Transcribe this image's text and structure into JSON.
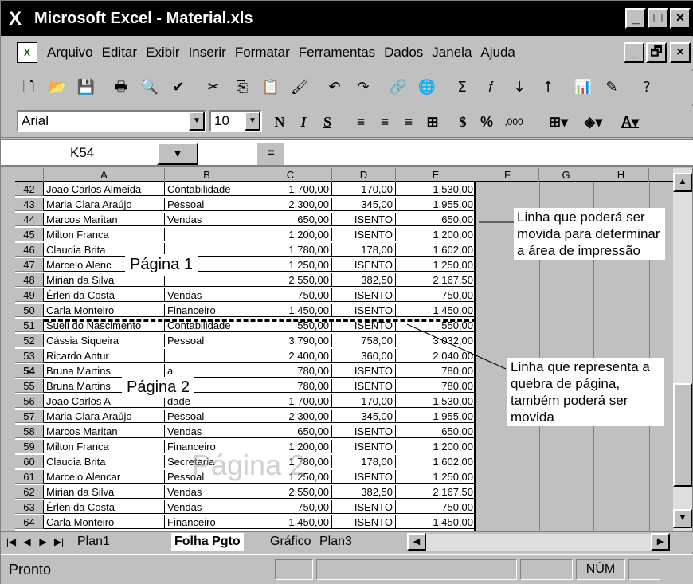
{
  "window": {
    "title": "Microsoft Excel - Material.xls",
    "app_icon": "X"
  },
  "window_buttons": {
    "minimize": "_",
    "maximize": "□",
    "close": "×"
  },
  "menu": {
    "items": [
      "Arquivo",
      "Editar",
      "Exibir",
      "Inserir",
      "Formatar",
      "Ferramentas",
      "Dados",
      "Janela",
      "Ajuda"
    ]
  },
  "toolbar_standard": [
    {
      "icon": "new-document-icon",
      "glyph": "🗋"
    },
    {
      "icon": "open-folder-icon",
      "glyph": "📂"
    },
    {
      "icon": "save-icon",
      "glyph": "💾"
    },
    {
      "icon": "print-icon",
      "glyph": "🖶"
    },
    {
      "icon": "print-preview-icon",
      "glyph": "🔍"
    },
    {
      "icon": "spelling-icon",
      "glyph": "✔"
    },
    {
      "icon": "cut-icon",
      "glyph": "✂"
    },
    {
      "icon": "copy-icon",
      "glyph": "⎘"
    },
    {
      "icon": "paste-icon",
      "glyph": "📋"
    },
    {
      "icon": "format-painter-icon",
      "glyph": "🖌"
    },
    {
      "icon": "undo-icon",
      "glyph": "↶"
    },
    {
      "icon": "redo-icon",
      "glyph": "↷"
    },
    {
      "icon": "hyperlink-icon",
      "glyph": "🔗"
    },
    {
      "icon": "web-toolbar-icon",
      "glyph": "🌐"
    },
    {
      "icon": "autosum-icon",
      "glyph": "Σ"
    },
    {
      "icon": "function-icon",
      "glyph": "𝑓"
    },
    {
      "icon": "sort-ascending-icon",
      "glyph": "↓"
    },
    {
      "icon": "sort-descending-icon",
      "glyph": "↑"
    },
    {
      "icon": "chart-wizard-icon",
      "glyph": "📊"
    },
    {
      "icon": "drawing-icon",
      "glyph": "✎"
    },
    {
      "icon": "help-icon",
      "glyph": "?"
    }
  ],
  "format": {
    "font": "Arial",
    "size": "10",
    "bold": "N",
    "italic": "I",
    "underline": "S",
    "percent": "%",
    "thousands": ",000"
  },
  "formula_bar": {
    "cell_ref": "K54",
    "equals": "="
  },
  "columns": [
    "A",
    "B",
    "C",
    "D",
    "E",
    "F",
    "G",
    "H"
  ],
  "rows": [
    {
      "n": "42",
      "a": "Joao Carlos Almeida",
      "b": "Contabilidade",
      "c": "1.700,00",
      "d": "170,00",
      "e": "1.530,00"
    },
    {
      "n": "43",
      "a": "Maria Clara Araújo",
      "b": "Pessoal",
      "c": "2.300,00",
      "d": "345,00",
      "e": "1.955,00"
    },
    {
      "n": "44",
      "a": "Marcos Maritan",
      "b": "Vendas",
      "c": "650,00",
      "d": "ISENTO",
      "e": "650,00"
    },
    {
      "n": "45",
      "a": "Milton Franca",
      "b": "",
      "c": "1.200,00",
      "d": "ISENTO",
      "e": "1.200,00"
    },
    {
      "n": "46",
      "a": "Claudia Brita",
      "b": "",
      "c": "1.780,00",
      "d": "178,00",
      "e": "1.602,00"
    },
    {
      "n": "47",
      "a": "Marcelo Alenc",
      "b": "",
      "c": "1.250,00",
      "d": "ISENTO",
      "e": "1.250,00"
    },
    {
      "n": "48",
      "a": "Mirian da Silva",
      "b": "",
      "c": "2.550,00",
      "d": "382,50",
      "e": "2.167,50"
    },
    {
      "n": "49",
      "a": "Érlen da Costa",
      "b": "Vendas",
      "c": "750,00",
      "d": "ISENTO",
      "e": "750,00"
    },
    {
      "n": "50",
      "a": "Carla Monteiro",
      "b": "Financeiro",
      "c": "1.450,00",
      "d": "ISENTO",
      "e": "1.450,00"
    },
    {
      "n": "51",
      "a": "Sueli do Nascimento",
      "b": "Contabilidade",
      "c": "550,00",
      "d": "ISENTO",
      "e": "550,00"
    },
    {
      "n": "52",
      "a": "Cássia Siqueira",
      "b": "Pessoal",
      "c": "3.790,00",
      "d": "758,00",
      "e": "3.032,00"
    },
    {
      "n": "53",
      "a": "Ricardo Antur",
      "b": "",
      "c": "2.400,00",
      "d": "360,00",
      "e": "2.040,00"
    },
    {
      "n": "54",
      "a": "Bruna Martins",
      "b": "a",
      "c": "780,00",
      "d": "ISENTO",
      "e": "780,00"
    },
    {
      "n": "55",
      "a": "Bruna Martins",
      "b": "a",
      "c": "780,00",
      "d": "ISENTO",
      "e": "780,00"
    },
    {
      "n": "56",
      "a": "Joao Carlos A",
      "b": "dade",
      "c": "1.700,00",
      "d": "170,00",
      "e": "1.530,00"
    },
    {
      "n": "57",
      "a": "Maria Clara Araújo",
      "b": "Pessoal",
      "c": "2.300,00",
      "d": "345,00",
      "e": "1.955,00"
    },
    {
      "n": "58",
      "a": "Marcos Maritan",
      "b": "Vendas",
      "c": "650,00",
      "d": "ISENTO",
      "e": "650,00"
    },
    {
      "n": "59",
      "a": "Milton Franca",
      "b": "Financeiro",
      "c": "1.200,00",
      "d": "ISENTO",
      "e": "1.200,00"
    },
    {
      "n": "60",
      "a": "Claudia Brita",
      "b": "Secretaria",
      "c": "1.780,00",
      "d": "178,00",
      "e": "1.602,00"
    },
    {
      "n": "61",
      "a": "Marcelo Alencar",
      "b": "Pessoal",
      "c": "1.250,00",
      "d": "ISENTO",
      "e": "1.250,00"
    },
    {
      "n": "62",
      "a": "Mirian da Silva",
      "b": "Vendas",
      "c": "2.550,00",
      "d": "382,50",
      "e": "2.167,50"
    },
    {
      "n": "63",
      "a": "Érlen da Costa",
      "b": "Vendas",
      "c": "750,00",
      "d": "ISENTO",
      "e": "750,00"
    },
    {
      "n": "64",
      "a": "Carla Monteiro",
      "b": "Financeiro",
      "c": "1.450,00",
      "d": "ISENTO",
      "e": "1.450,00"
    }
  ],
  "page_labels": {
    "page1": "Página 1",
    "page2": "Página 2",
    "watermark": "Página 2"
  },
  "annotations": {
    "print_area": "Linha que poderá ser movida para determinar a área de impressão",
    "page_break": "Linha que representa a quebra de página, também poderá ser movida"
  },
  "sheets": {
    "tabs": [
      "Plan1",
      "Folha Pgto",
      "Gráfico",
      "Plan3"
    ],
    "active": "Folha Pgto"
  },
  "status": {
    "text": "Pronto",
    "num": "NÚM"
  }
}
